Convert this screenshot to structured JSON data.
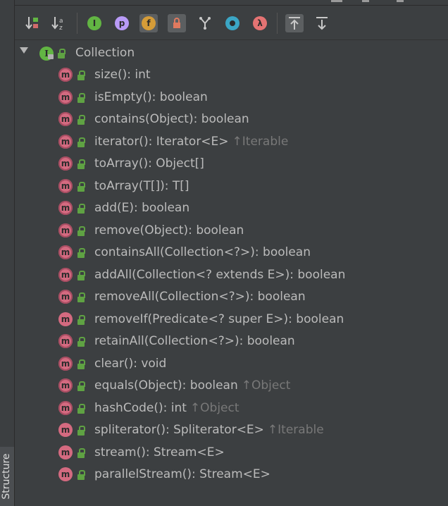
{
  "side_tab": {
    "label": "Structure"
  },
  "toolbar": {
    "buttons": [
      {
        "name": "sort-by-visibility-button",
        "icon": "sort-visibility-icon",
        "active": false
      },
      {
        "name": "sort-alphabetically-button",
        "icon": "sort-alpha-icon",
        "active": false
      },
      {
        "name": "show-inherited-button",
        "icon": "inherited-icon",
        "glyph": "I",
        "color": "#62b543",
        "active": false
      },
      {
        "name": "show-properties-button",
        "icon": "property-icon",
        "glyph": "p",
        "color": "#b99bf8",
        "active": false
      },
      {
        "name": "show-fields-button",
        "icon": "field-icon",
        "glyph": "f",
        "color": "#d59c38",
        "active": true
      },
      {
        "name": "show-non-public-button",
        "icon": "lock-icon",
        "color": "#e07a5f",
        "active": true
      },
      {
        "name": "show-anonymous-classes-button",
        "icon": "anonymous-class-icon",
        "active": false
      },
      {
        "name": "show-interfaces-button",
        "icon": "target-icon",
        "color": "#3ba6c5",
        "active": false
      },
      {
        "name": "show-lambdas-button",
        "icon": "lambda-icon",
        "glyph": "λ",
        "color": "#e57373",
        "active": false
      },
      {
        "name": "autoscroll-to-source-button",
        "icon": "autoscroll-to-source-icon",
        "active": true
      },
      {
        "name": "autoscroll-from-source-button",
        "icon": "autoscroll-from-source-icon",
        "active": false
      }
    ]
  },
  "tree": {
    "root": {
      "label": "Collection",
      "icon_glyph": "I"
    },
    "method_glyph": "m",
    "methods": [
      {
        "label": "size(): int",
        "inherited": ""
      },
      {
        "label": "isEmpty(): boolean",
        "inherited": ""
      },
      {
        "label": "contains(Object): boolean",
        "inherited": ""
      },
      {
        "label": "iterator(): Iterator<E>",
        "inherited": "↑Iterable"
      },
      {
        "label": "toArray(): Object[]",
        "inherited": ""
      },
      {
        "label": "toArray(T[]): T[]",
        "inherited": ""
      },
      {
        "label": "add(E): boolean",
        "inherited": ""
      },
      {
        "label": "remove(Object): boolean",
        "inherited": ""
      },
      {
        "label": "containsAll(Collection<?>): boolean",
        "inherited": ""
      },
      {
        "label": "addAll(Collection<? extends E>): boolean",
        "inherited": ""
      },
      {
        "label": "removeAll(Collection<?>): boolean",
        "inherited": ""
      },
      {
        "label": "removeIf(Predicate<? super E>): boolean",
        "inherited": ""
      },
      {
        "label": "retainAll(Collection<?>): boolean",
        "inherited": ""
      },
      {
        "label": "clear(): void",
        "inherited": ""
      },
      {
        "label": "equals(Object): boolean",
        "inherited": "↑Object"
      },
      {
        "label": "hashCode(): int",
        "inherited": "↑Object"
      },
      {
        "label": "spliterator(): Spliterator<E>",
        "inherited": "↑Iterable"
      },
      {
        "label": "stream(): Stream<E>",
        "inherited": ""
      },
      {
        "label": "parallelStream(): Stream<E>",
        "inherited": ""
      }
    ],
    "abstract_flags": [
      true,
      true,
      true,
      true,
      true,
      true,
      true,
      true,
      true,
      true,
      true,
      false,
      true,
      true,
      true,
      true,
      false,
      false,
      false
    ]
  }
}
